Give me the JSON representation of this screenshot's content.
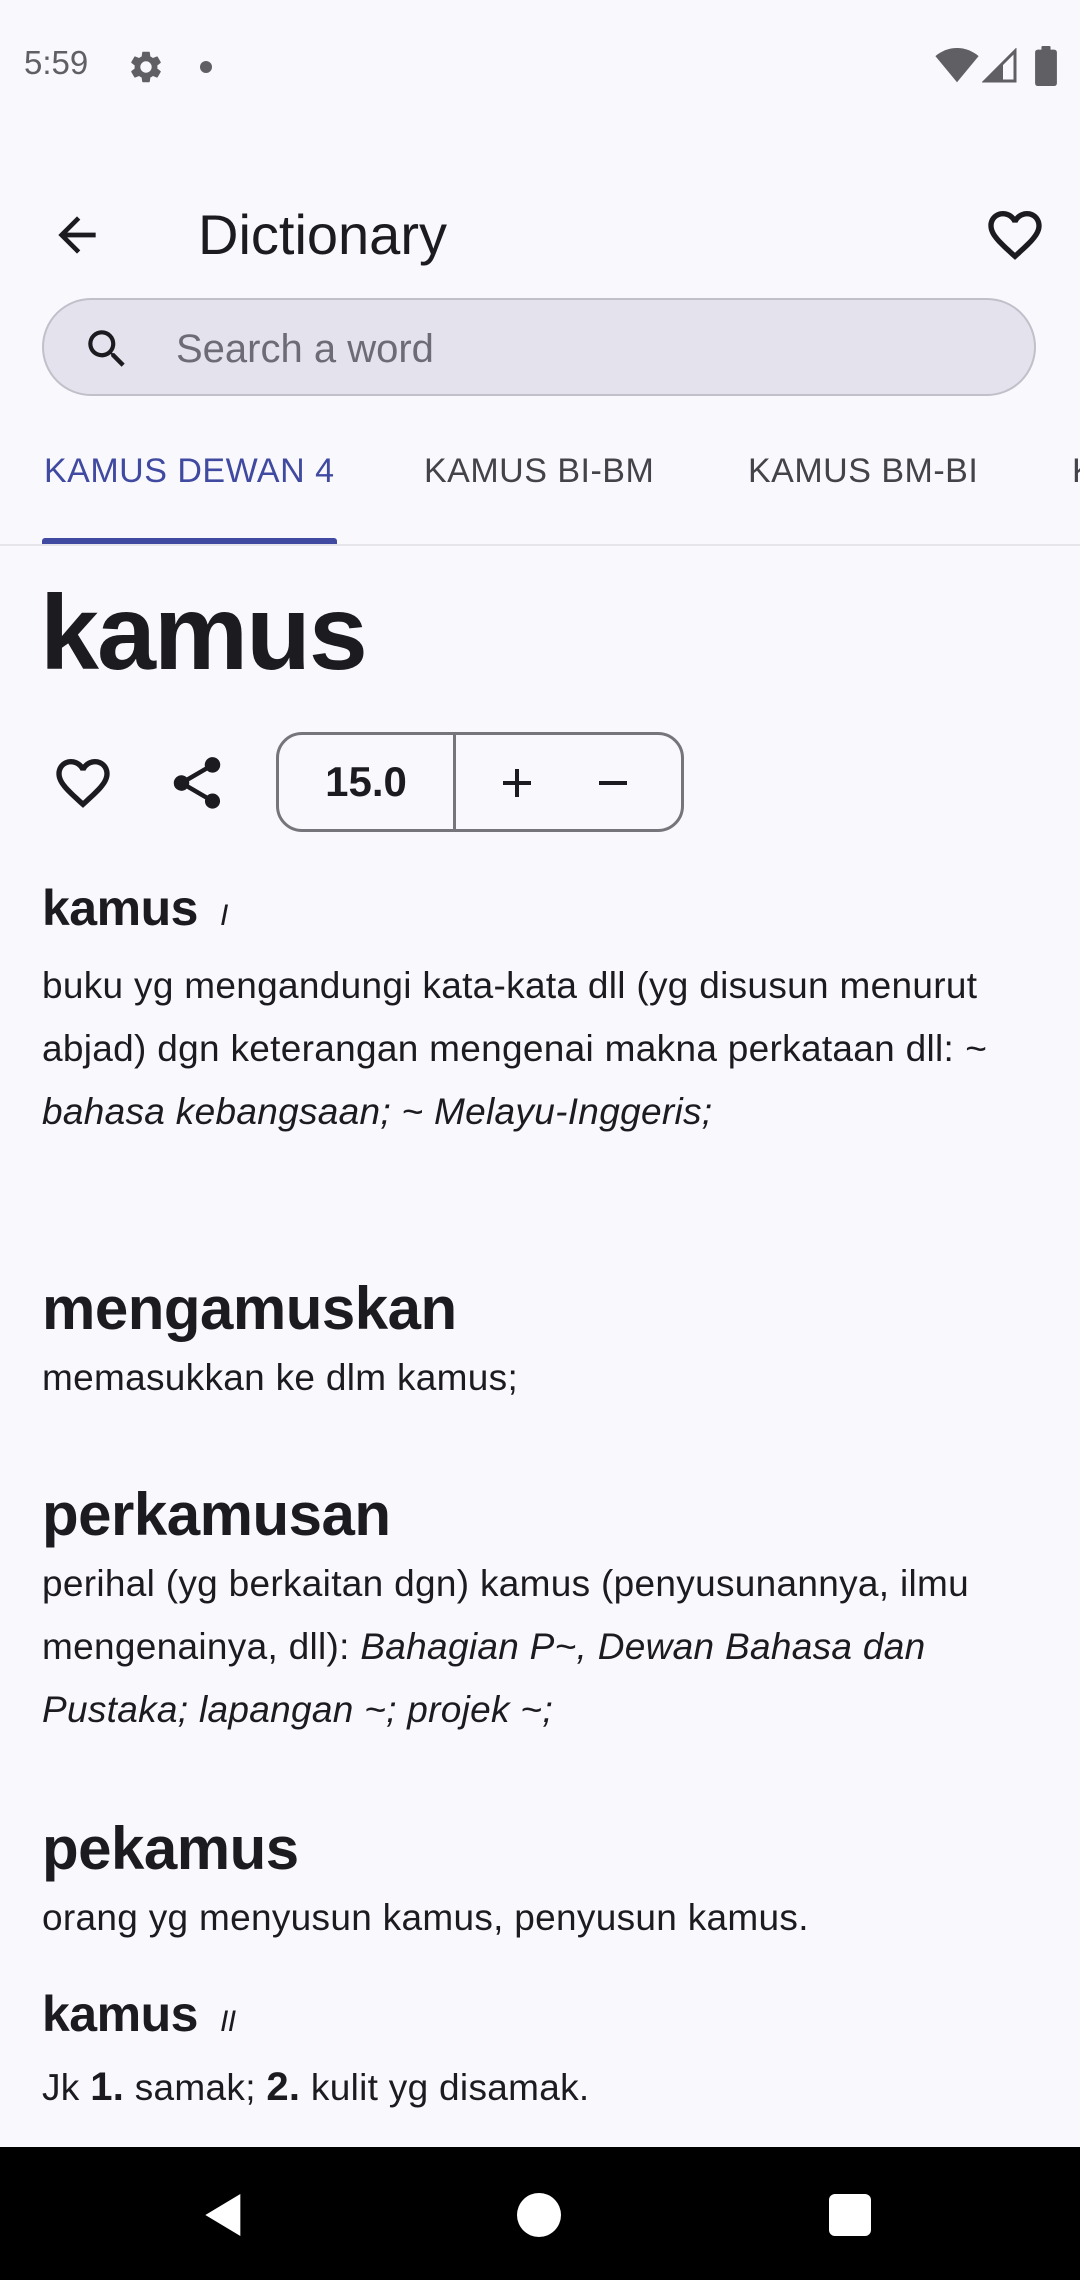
{
  "status_bar": {
    "time": "5:59"
  },
  "app_bar": {
    "title": "Dictionary"
  },
  "search": {
    "placeholder": "Search a word",
    "value": ""
  },
  "tabs": [
    {
      "label": "KAMUS DEWAN 4",
      "active": true
    },
    {
      "label": "KAMUS BI-BM",
      "active": false
    },
    {
      "label": "KAMUS BM-BI",
      "active": false
    },
    {
      "label": "K",
      "active": false
    }
  ],
  "word": {
    "title": "kamus"
  },
  "font_size": {
    "value": "15.0"
  },
  "entries": {
    "e1": {
      "headword": "kamus",
      "mark": "I",
      "def": "buku yg mengandungi kata-kata dll (yg disusun menurut abjad) dgn keterangan mengenai makna perkataan dll: ",
      "example": "~ bahasa kebangsaan; ~ Melayu-Inggeris;"
    },
    "e2": {
      "headword": "mengamuskan",
      "def": "memasukkan ke dlm kamus;"
    },
    "e3": {
      "headword": "perkamusan",
      "def": "perihal (yg berkaitan dgn) kamus (penyusunannya, ilmu mengenainya, dll): ",
      "example": "Bahagian P~, Dewan Bahasa dan Pustaka; lapangan ~; projek ~;"
    },
    "e4": {
      "headword": "pekamus",
      "def": "orang yg menyusun kamus, penyusun kamus."
    },
    "e5": {
      "headword": "kamus",
      "mark": "II",
      "prefix": "Jk ",
      "n1": "1.",
      "t1": " samak; ",
      "n2": "2.",
      "t2": " kulit yg disamak."
    }
  },
  "colors": {
    "accent": "#3f4aa0",
    "background": "#f9f8fc",
    "search_bg": "#e4e3ed"
  },
  "icons": [
    "gear-icon",
    "wifi-icon",
    "signal-icon",
    "battery-icon",
    "back-arrow-icon",
    "heart-outline-icon",
    "search-icon",
    "share-icon",
    "plus-icon",
    "minus-icon"
  ]
}
